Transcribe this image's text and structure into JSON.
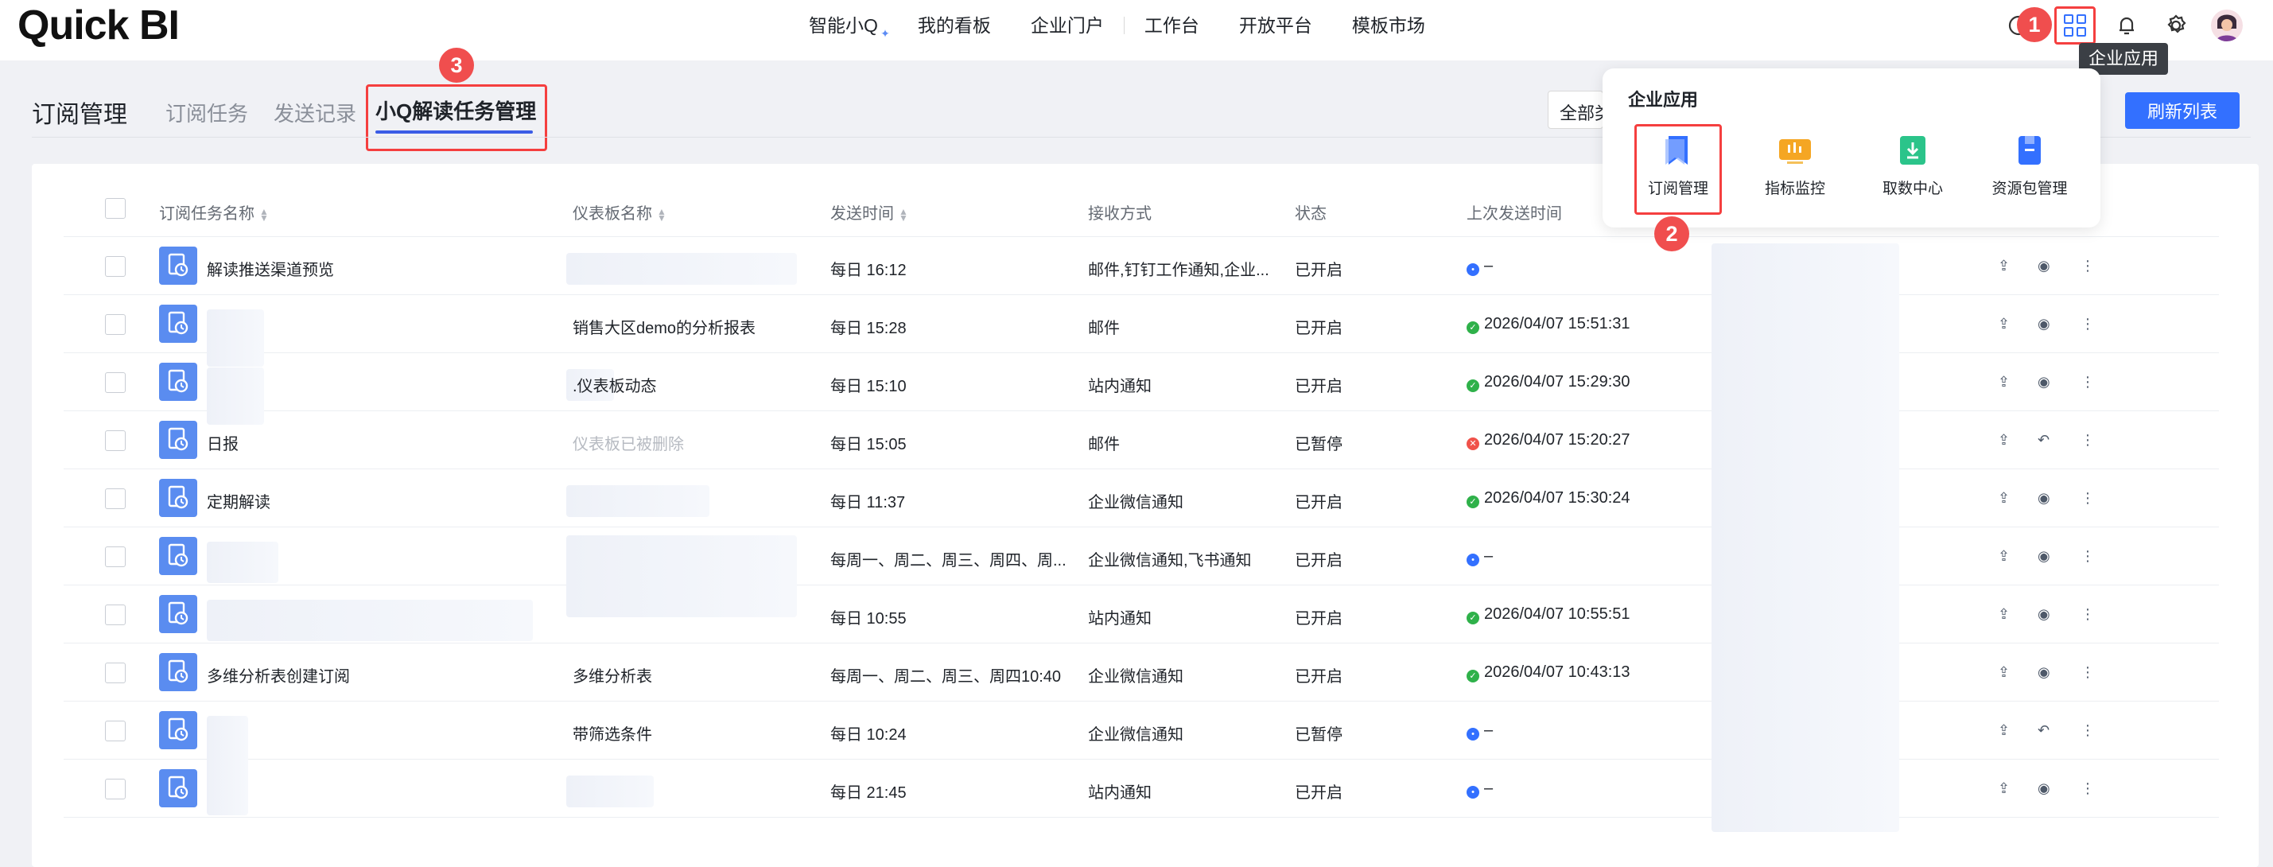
{
  "app": {
    "logo": "Quick BI"
  },
  "topnav": {
    "items": [
      "智能小Q",
      "我的看板",
      "企业门户",
      "工作台",
      "开放平台",
      "模板市场"
    ]
  },
  "tooltip": "企业应用",
  "badges": {
    "b1": "1",
    "b2": "2",
    "b3": "3"
  },
  "page": {
    "title": "订阅管理",
    "tabs": [
      "订阅任务",
      "发送记录",
      "小Q解读任务管理"
    ]
  },
  "filter": {
    "value": "全部类型"
  },
  "refresh_label": "刷新列表",
  "table": {
    "headers": [
      "订阅任务名称",
      "仪表板名称",
      "发送时间",
      "接收方式",
      "状态",
      "上次发送时间"
    ],
    "rows": [
      {
        "name": "解读推送渠道预览",
        "dashboard": "",
        "time": "每日 16:12",
        "method": "邮件,钉钉工作通知,企业...",
        "status": "已开启",
        "last": "–",
        "last_state": "pending"
      },
      {
        "name": "",
        "dashboard": "销售大区demo的分析报表",
        "time": "每日 15:28",
        "method": "邮件",
        "status": "已开启",
        "last": "2026/04/07 15:51:31",
        "last_state": "ok"
      },
      {
        "name": "",
        "dashboard": ".仪表板动态",
        "time": "每日 15:10",
        "method": "站内通知",
        "status": "已开启",
        "last": "2026/04/07 15:29:30",
        "last_state": "ok"
      },
      {
        "name": "日报",
        "dashboard": "仪表板已被删除",
        "time": "每日 15:05",
        "method": "邮件",
        "status": "已暂停",
        "last": "2026/04/07 15:20:27",
        "last_state": "error"
      },
      {
        "name": "定期解读",
        "dashboard": "",
        "time": "每日 11:37",
        "method": "企业微信通知",
        "status": "已开启",
        "last": "2026/04/07 15:30:24",
        "last_state": "ok"
      },
      {
        "name": "",
        "dashboard": "",
        "time": "每周一、周二、周三、周四、周...",
        "method": "企业微信通知,飞书通知",
        "status": "已开启",
        "last": "–",
        "last_state": "pending"
      },
      {
        "name": "",
        "dashboard": "",
        "time": "每日 10:55",
        "method": "站内通知",
        "status": "已开启",
        "last": "2026/04/07 10:55:51",
        "last_state": "ok"
      },
      {
        "name": "多维分析表创建订阅",
        "dashboard": "多维分析表",
        "time": "每周一、周二、周三、周四10:40",
        "method": "企业微信通知",
        "status": "已开启",
        "last": "2026/04/07 10:43:13",
        "last_state": "ok"
      },
      {
        "name": "",
        "dashboard": "带筛选条件",
        "time": "每日 10:24",
        "method": "企业微信通知",
        "status": "已暂停",
        "last": "–",
        "last_state": "pending"
      },
      {
        "name": "",
        "dashboard": "",
        "time": "每日 21:45",
        "method": "站内通知",
        "status": "已开启",
        "last": "–",
        "last_state": "pending"
      }
    ]
  },
  "popup": {
    "title": "企业应用",
    "apps": [
      "订阅管理",
      "指标监控",
      "取数中心",
      "资源包管理"
    ]
  },
  "colors": {
    "accent": "#3370ff",
    "highlight": "#f53f3f",
    "ok": "#2fb14a",
    "error": "#f0524a"
  }
}
